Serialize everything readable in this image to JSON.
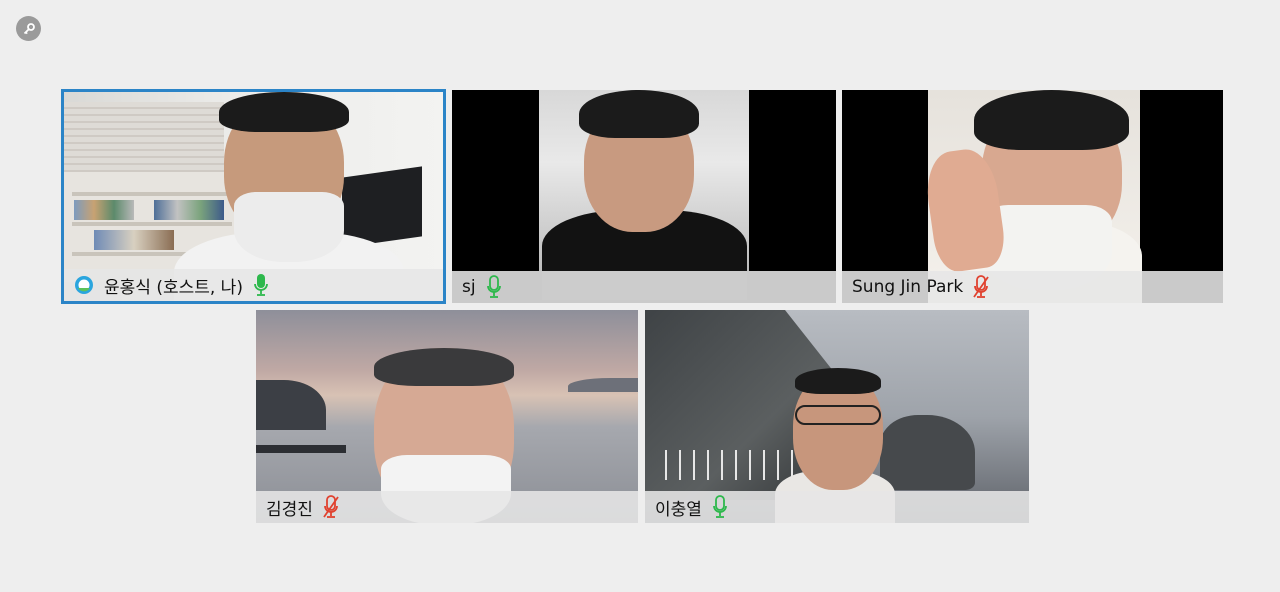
{
  "window": {
    "corner_button_icon": "key-icon"
  },
  "participants": [
    {
      "name": "윤홍식 (호스트, 나)",
      "mic": "on",
      "is_host": true,
      "active_speaker": true
    },
    {
      "name": "sj",
      "mic": "on",
      "is_host": false,
      "active_speaker": false
    },
    {
      "name": "Sung Jin Park",
      "mic": "muted",
      "is_host": false,
      "active_speaker": false
    },
    {
      "name": "김경진",
      "mic": "muted",
      "is_host": false,
      "active_speaker": false
    },
    {
      "name": "이충열",
      "mic": "on",
      "is_host": false,
      "active_speaker": false
    }
  ],
  "colors": {
    "mic_on": "#2db84c",
    "mic_muted": "#e0422f",
    "active_border": "#2b84c7",
    "background": "#eeeeee"
  }
}
